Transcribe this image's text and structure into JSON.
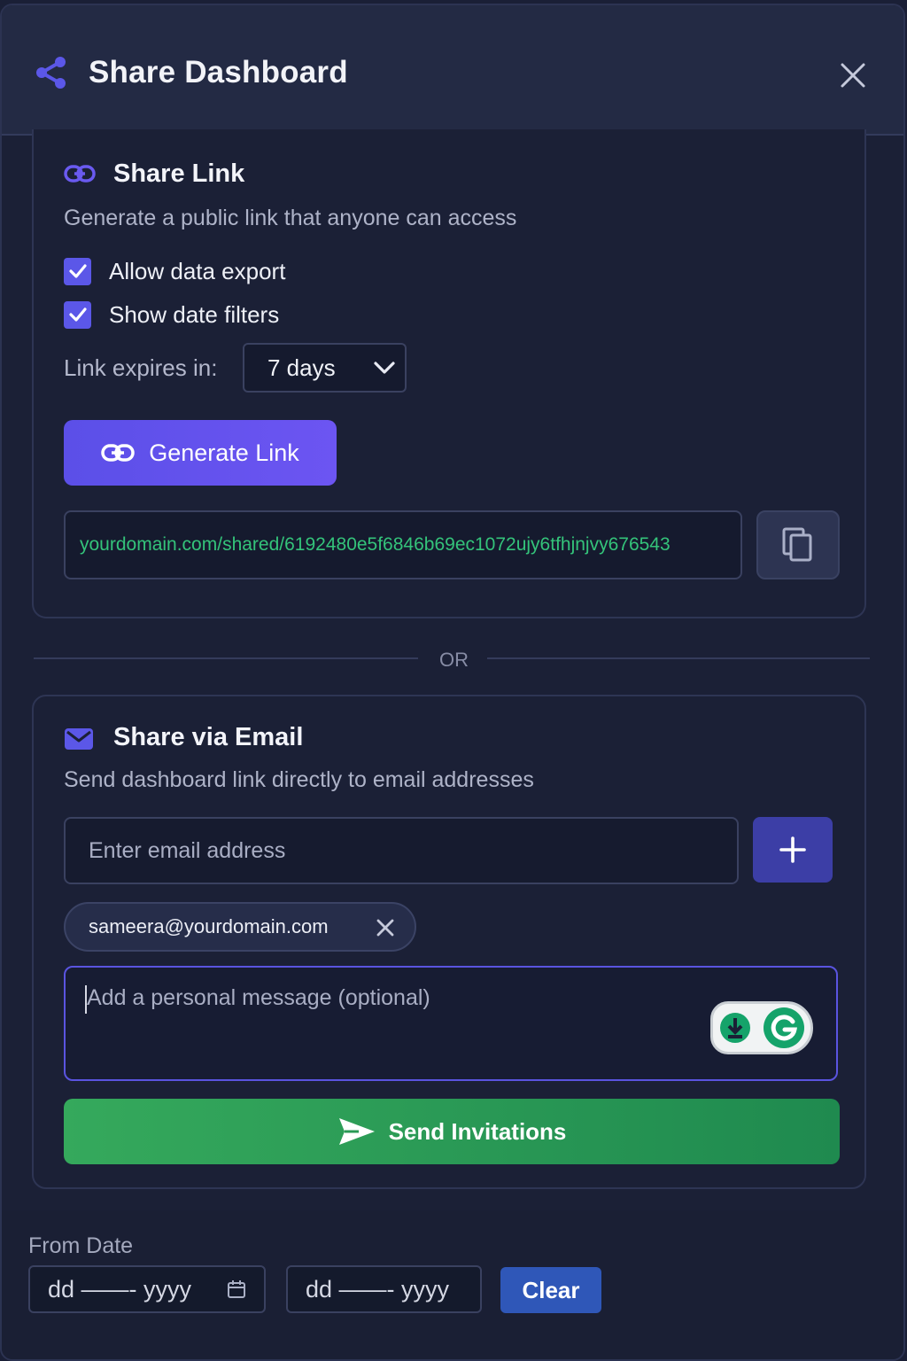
{
  "header": {
    "title": "Share Dashboard",
    "icon": "share-icon",
    "close_icon": "close-icon"
  },
  "share_link": {
    "title": "Share Link",
    "description": "Generate a public link that anyone can access",
    "options": [
      {
        "label": "Allow data export",
        "checked": true
      },
      {
        "label": "Show date filters",
        "checked": true
      }
    ],
    "expires_label": "Link expires in:",
    "expires_value": "7 days",
    "generate_label": "Generate Link",
    "url": "yourdomain.com/shared/6192480e5f6846b69ec1072ujy6tfhjnjvy676543"
  },
  "divider_text": "OR",
  "email": {
    "title": "Share via Email",
    "description": "Send dashboard link directly to email addresses",
    "input_placeholder": "Enter email address",
    "chips": [
      "sameera@yourdomain.com"
    ],
    "message_placeholder": "Add a personal message (optional)",
    "send_label": "Send Invitations"
  },
  "filters": {
    "from_label": "From Date",
    "from_placeholder": "dd ——- yyyy",
    "to_placeholder": "dd ——- yyyy",
    "clear_label": "Clear"
  },
  "colors": {
    "accent": "#5b57e8",
    "success": "#2f9e58",
    "link_text": "#34c37a",
    "clear": "#2f57b8"
  }
}
